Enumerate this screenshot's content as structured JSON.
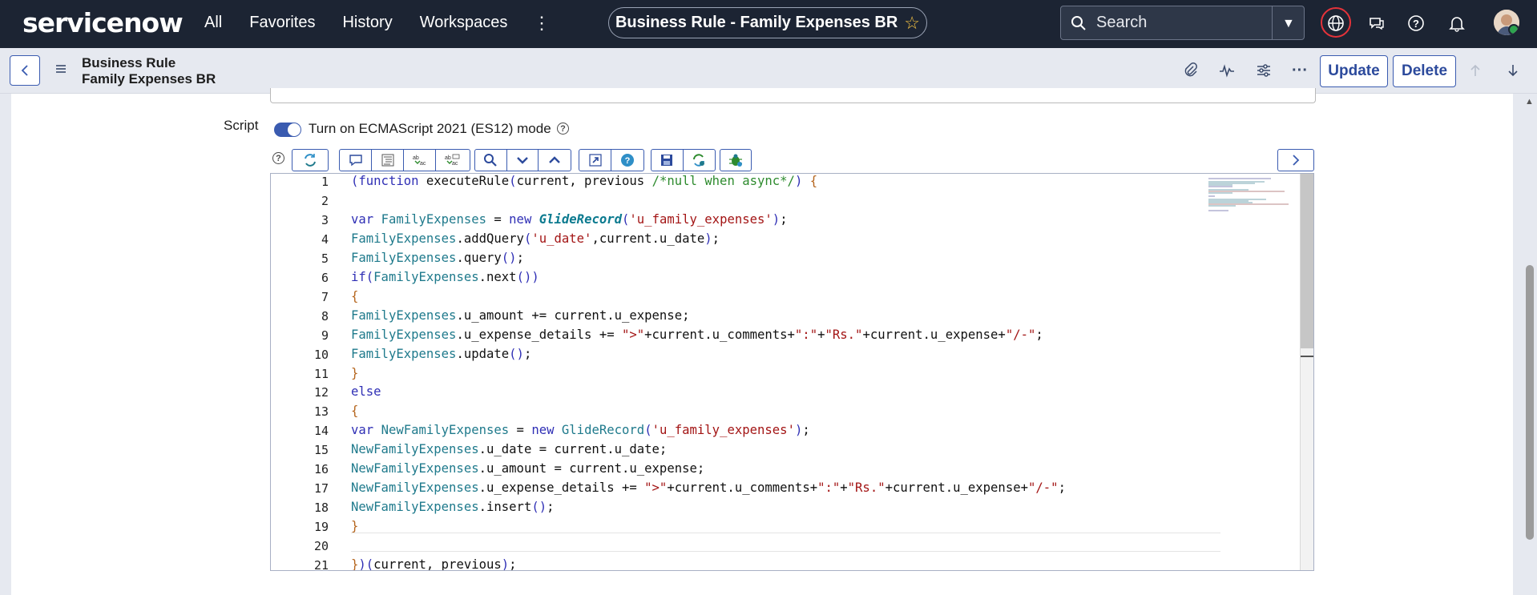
{
  "topnav": {
    "logo": "servicenow",
    "links": [
      "All",
      "Favorites",
      "History",
      "Workspaces"
    ],
    "record_title": "Business Rule - Family Expenses BR",
    "search_placeholder": "Search",
    "icons": [
      "globe-icon",
      "chat-icon",
      "help-icon",
      "bell-icon",
      "avatar"
    ]
  },
  "subheader": {
    "record_type": "Business Rule",
    "record_name": "Family Expenses BR",
    "update_label": "Update",
    "delete_label": "Delete"
  },
  "form": {
    "script_label": "Script",
    "es_toggle_label": "Turn on ECMAScript 2021 (ES12) mode",
    "es_toggle_on": true
  },
  "editor": {
    "line_numbers": [
      "1",
      "2",
      "3",
      "4",
      "5",
      "6",
      "7",
      "8",
      "9",
      "10",
      "11",
      "12",
      "13",
      "14",
      "15",
      "16",
      "17",
      "18",
      "19",
      "20",
      "21"
    ],
    "lines": [
      "(function executeRule(current, previous /*null when async*/) {",
      "",
      "var FamilyExpenses = new GlideRecord('u_family_expenses');",
      "FamilyExpenses.addQuery('u_date',current.u_date);",
      "FamilyExpenses.query();",
      "if(FamilyExpenses.next())",
      "{",
      "FamilyExpenses.u_amount += current.u_expense;",
      "FamilyExpenses.u_expense_details += \">\"+current.u_comments+\":\"+\"Rs.\"+current.u_expense+\"/-\";",
      "FamilyExpenses.update();",
      "}",
      "else",
      "{",
      "var NewFamilyExpenses = new GlideRecord('u_family_expenses');",
      "NewFamilyExpenses.u_date = current.u_date;",
      "NewFamilyExpenses.u_amount = current.u_expense;",
      "NewFamilyExpenses.u_expense_details += \">\"+current.u_comments+\":\"+\"Rs.\"+current.u_expense+\"/-\";",
      "NewFamilyExpenses.insert();",
      "}",
      "",
      "})(current, previous);"
    ],
    "colors": {
      "keyword": "#2f2fb5",
      "variable": "#1f7a8c",
      "string": "#a31515",
      "comment": "#2e8b2e"
    }
  }
}
